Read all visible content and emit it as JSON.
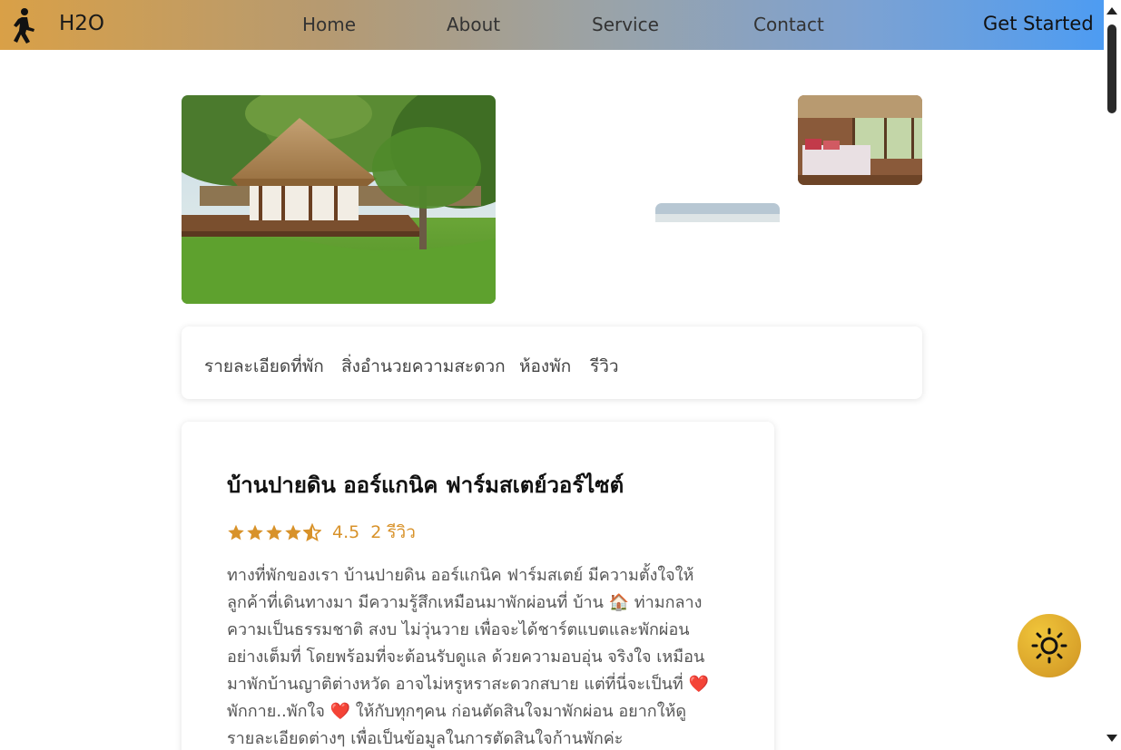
{
  "nav": {
    "logo_text": "H2O",
    "links": [
      "Home",
      "About",
      "Service",
      "Contact"
    ],
    "cta": "Get Started",
    "logo_icon": "walking-person-icon"
  },
  "tabs": [
    "รายละเอียดที่พัก",
    "สิ่งอำนวยความสะดวก",
    "ห้องพัก",
    "รีวิว"
  ],
  "listing": {
    "title": "บ้านปายดิน ออร์แกนิค ฟาร์มสเตย์วอร์ไซต์",
    "rating": "4.5",
    "rating_value": 4.5,
    "reviews": "2 รีวิว",
    "description": "ทางที่พักของเรา บ้านปายดิน ออร์แกนิค ฟาร์มสเตย์ มีความตั้งใจให้\nลูกค้าที่เดินทางมา มีความรู้สึกเหมือนมาพักผ่อนที่ บ้าน 🏠 ท่ามกลาง\nความเป็นธรรมชาติ สงบ ไม่วุ่นวาย เพื่อจะได้ชาร์ตแบตและพักผ่อน\nอย่างเต็มที่ โดยพร้อมที่จะต้อนรับดูแล ด้วยความอบอุ่น จริงใจ เหมือน\nมาพักบ้านญาติต่างหวัด อาจไม่หรูหราสะดวกสบาย แต่ที่นี่จะเป็นที่ ❤️\nพักกาย..พักใจ ❤️ ให้กับทุกๆคน ก่อนตัดสินใจมาพักผ่อน อยากให้ดู\nรายละเอียดต่างๆ เพื่อเป็นข้อมูลในการตัดสินใจก้านพักค่ะ"
  },
  "colors": {
    "accent": "#d8922a",
    "header_start": "#d9a047",
    "header_end": "#4d9cf2"
  },
  "icons": {
    "star": "star-icon",
    "theme": "sun-icon"
  }
}
